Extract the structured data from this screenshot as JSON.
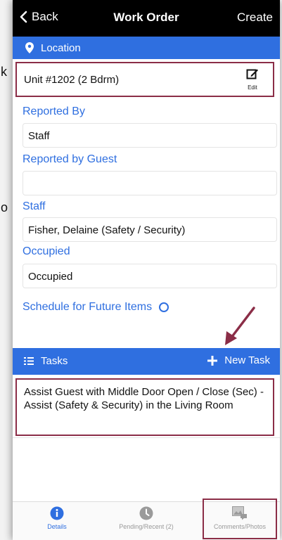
{
  "edge_chars": [
    "k",
    "o"
  ],
  "nav": {
    "back_label": "Back",
    "title": "Work Order",
    "create_label": "Create"
  },
  "location": {
    "header": "Location",
    "unit": "Unit #1202 (2 Bdrm)",
    "edit_label": "Edit"
  },
  "fields": {
    "reported_by_label": "Reported By",
    "reported_by_value": "Staff",
    "reported_by_guest_label": "Reported by Guest",
    "reported_by_guest_value": "",
    "staff_label": "Staff",
    "staff_value": "Fisher, Delaine (Safety / Security)",
    "occupied_label": "Occupied",
    "occupied_value": "Occupied"
  },
  "schedule": {
    "label": "Schedule for Future Items"
  },
  "tasks": {
    "header": "Tasks",
    "new_task_label": "New Task",
    "items": [
      "Assist Guest with Middle Door Open / Close (Sec) - Assist (Safety & Security) in the Living Room"
    ]
  },
  "tabbar": {
    "tabs": [
      {
        "label": "Details",
        "icon": "info-icon",
        "active": true
      },
      {
        "label": "Pending/Recent (2)",
        "icon": "clock-icon",
        "active": false
      },
      {
        "label": "Comments/Photos",
        "icon": "photos-icon",
        "active": false
      }
    ]
  },
  "colors": {
    "accent": "#2f6fe0",
    "highlight": "#8b2d47",
    "navbar": "#000000"
  }
}
